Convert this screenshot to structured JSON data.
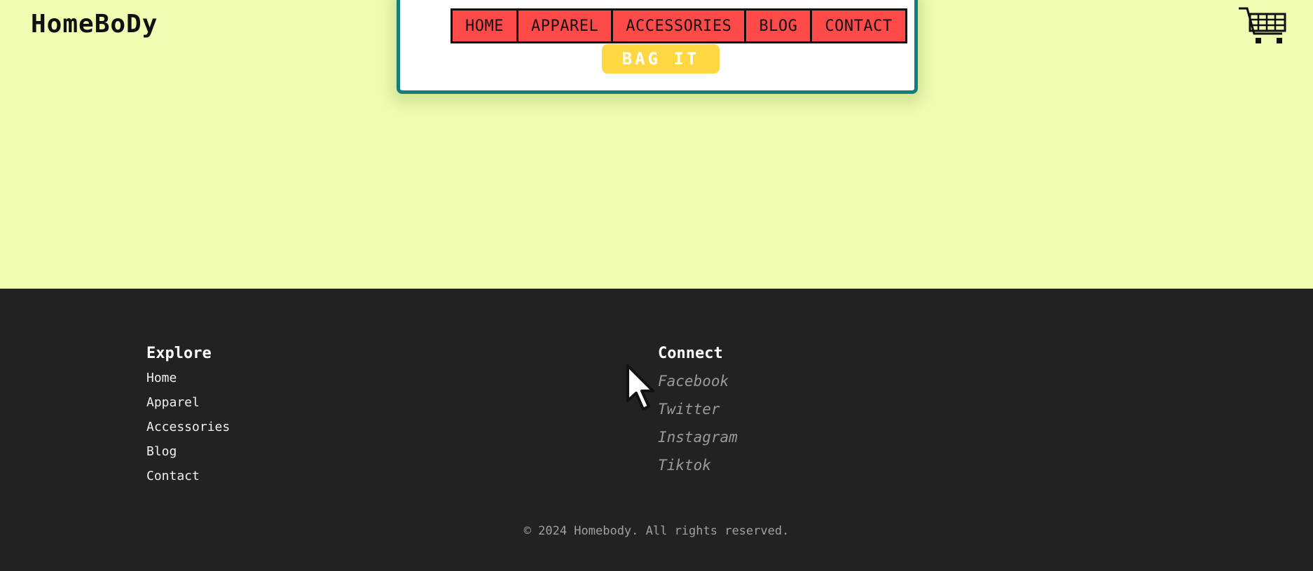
{
  "header": {
    "logo": "HomeBoDy",
    "cart_icon": "shopping-cart-icon"
  },
  "nav": {
    "items": [
      "HOME",
      "APPAREL",
      "ACCESSORIES",
      "BLOG",
      "CONTACT"
    ],
    "bag_button": "BAG IT"
  },
  "footer": {
    "explore": {
      "title": "Explore",
      "links": [
        "Home",
        "Apparel",
        "Accessories",
        "Blog",
        "Contact"
      ]
    },
    "connect": {
      "title": "Connect",
      "links": [
        "Facebook",
        "Twitter",
        "Instagram",
        "Tiktok"
      ]
    },
    "copyright": "© 2024 Homebody. All rights reserved."
  },
  "colors": {
    "background": "#f1fcb3",
    "nav_item": "#ff4a4a",
    "card_border": "#137c7c",
    "button": "#ffd743",
    "footer": "#222222"
  }
}
